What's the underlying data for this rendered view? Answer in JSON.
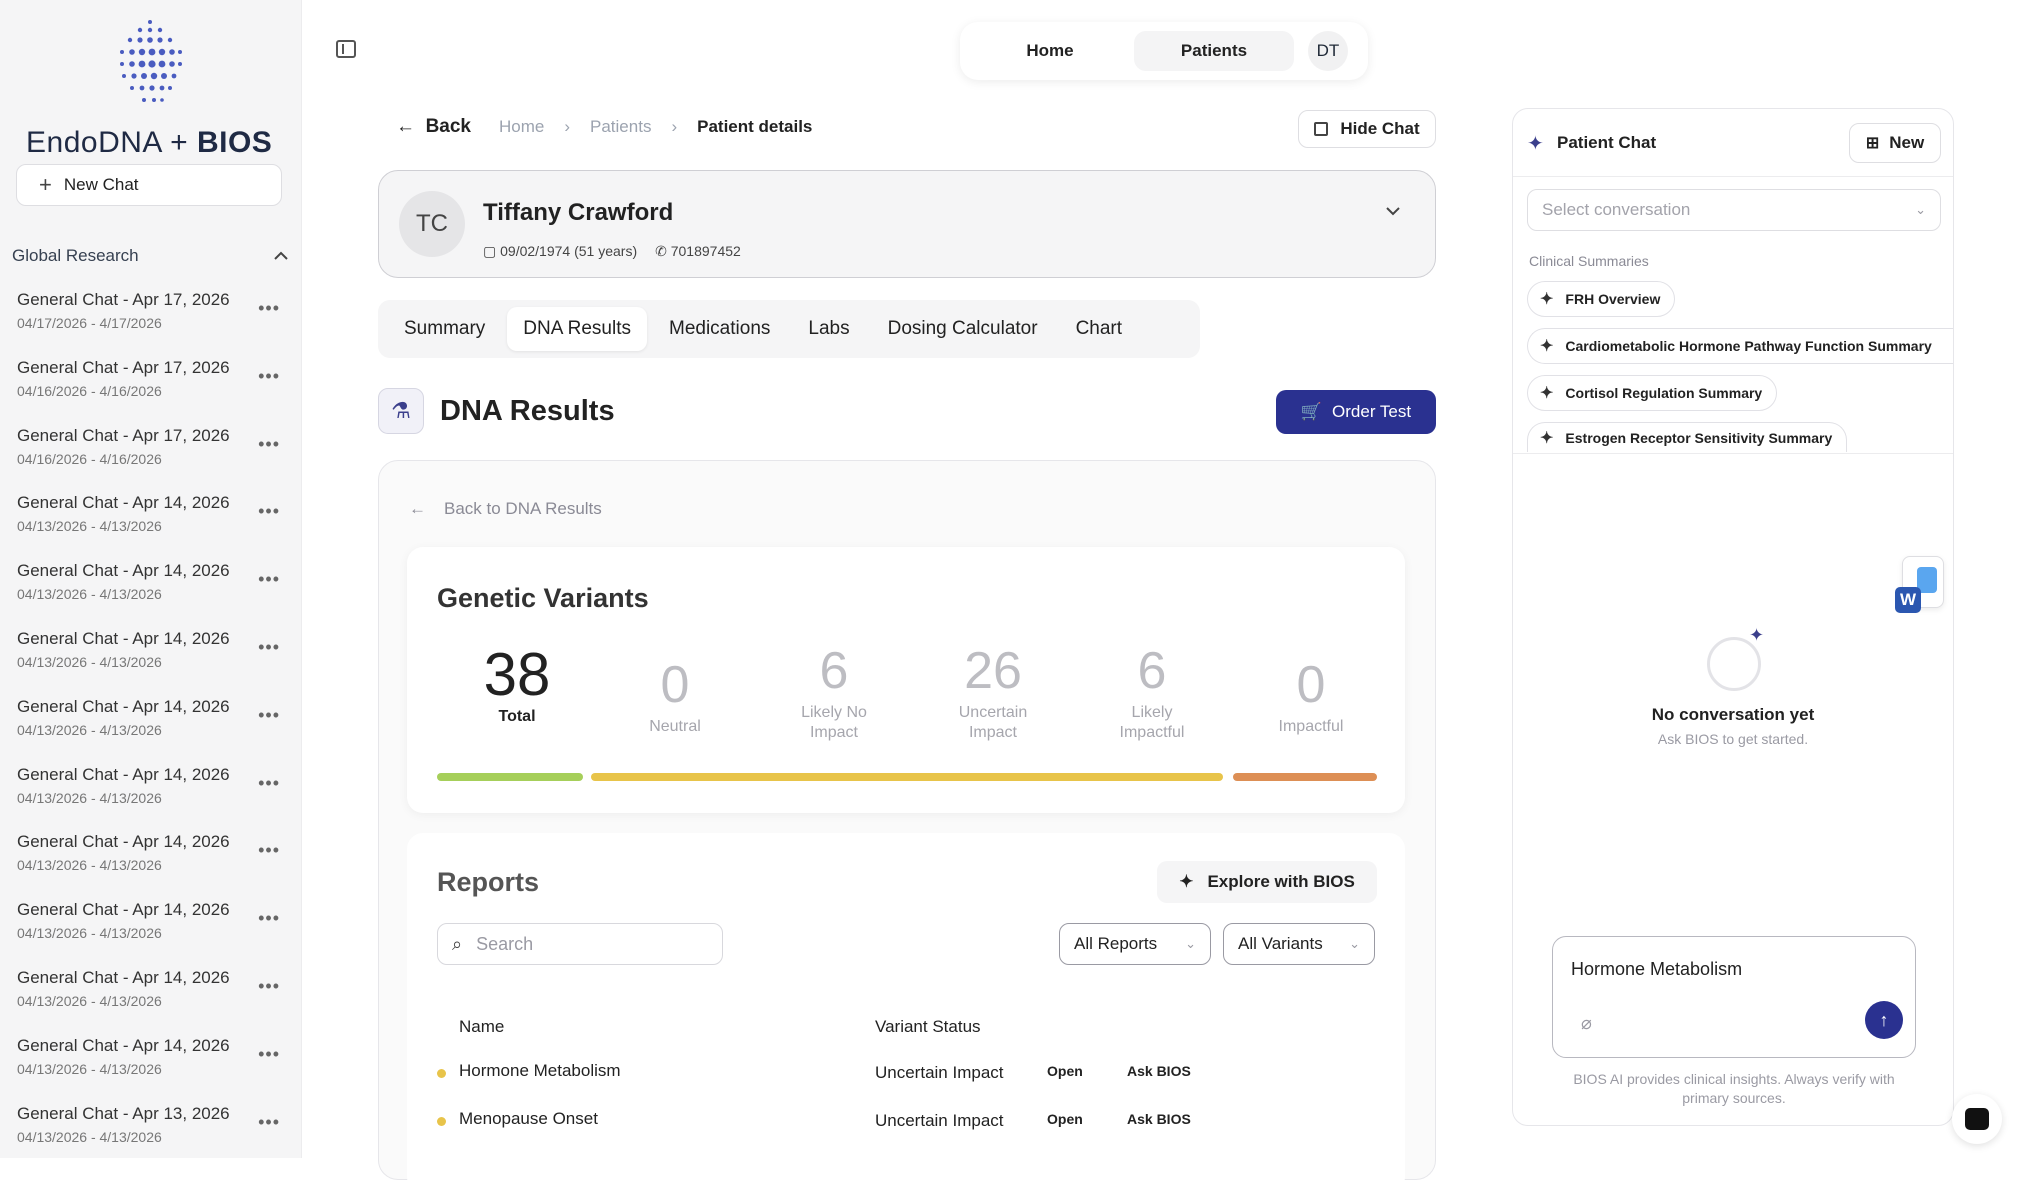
{
  "brand": {
    "name_left": "EndoDNA",
    "name_plus": "+",
    "name_right": "BIOS"
  },
  "sidebar": {
    "new_chat_label": "New Chat",
    "section_title": "Global Research",
    "chats": [
      {
        "title": "General Chat - Apr 17, 2026",
        "range": "04/17/2026 - 4/17/2026"
      },
      {
        "title": "General Chat - Apr 17, 2026",
        "range": "04/16/2026 - 4/16/2026"
      },
      {
        "title": "General Chat - Apr 17, 2026",
        "range": "04/16/2026 - 4/16/2026"
      },
      {
        "title": "General Chat - Apr 14, 2026",
        "range": "04/13/2026 - 4/13/2026"
      },
      {
        "title": "General Chat - Apr 14, 2026",
        "range": "04/13/2026 - 4/13/2026"
      },
      {
        "title": "General Chat - Apr 14, 2026",
        "range": "04/13/2026 - 4/13/2026"
      },
      {
        "title": "General Chat - Apr 14, 2026",
        "range": "04/13/2026 - 4/13/2026"
      },
      {
        "title": "General Chat - Apr 14, 2026",
        "range": "04/13/2026 - 4/13/2026"
      },
      {
        "title": "General Chat - Apr 14, 2026",
        "range": "04/13/2026 - 4/13/2026"
      },
      {
        "title": "General Chat - Apr 14, 2026",
        "range": "04/13/2026 - 4/13/2026"
      },
      {
        "title": "General Chat - Apr 14, 2026",
        "range": "04/13/2026 - 4/13/2026"
      },
      {
        "title": "General Chat - Apr 14, 2026",
        "range": "04/13/2026 - 4/13/2026"
      },
      {
        "title": "General Chat - Apr 13, 2026",
        "range": "04/13/2026 - 4/13/2026"
      }
    ]
  },
  "topnav": {
    "home": "Home",
    "patients": "Patients",
    "user_initials": "DT"
  },
  "breadcrumb": {
    "back": "Back",
    "home": "Home",
    "patients": "Patients",
    "current": "Patient details"
  },
  "hide_chat_label": "Hide Chat",
  "patient": {
    "initials": "TC",
    "name": "Tiffany Crawford",
    "dob": "09/02/1974 (51 years)",
    "phone": "701897452"
  },
  "tabs": [
    "Summary",
    "DNA Results",
    "Medications",
    "Labs",
    "Dosing Calculator",
    "Chart"
  ],
  "active_tab": "DNA Results",
  "dna": {
    "title": "DNA Results",
    "order_label": "Order Test",
    "back_label": "Back to DNA Results"
  },
  "variants": {
    "title": "Genetic Variants",
    "total": {
      "value": "38",
      "label": "Total"
    },
    "stats": [
      {
        "value": "0",
        "label": "Neutral"
      },
      {
        "value": "6",
        "label": "Likely No Impact"
      },
      {
        "value": "26",
        "label": "Uncertain Impact"
      },
      {
        "value": "6",
        "label": "Likely Impactful"
      },
      {
        "value": "0",
        "label": "Impactful"
      }
    ],
    "bar_colors": {
      "green": "#a6cf5a",
      "yellow": "#e8c44a",
      "orange": "#dd8f55"
    }
  },
  "reports": {
    "title": "Reports",
    "explore_label": "Explore with BIOS",
    "search_placeholder": "Search",
    "filter_reports": "All Reports",
    "filter_variants": "All Variants",
    "col_name": "Name",
    "col_status": "Variant Status",
    "rows": [
      {
        "name": "Hormone Metabolism",
        "status": "Uncertain Impact",
        "open": "Open",
        "ask": "Ask BIOS"
      },
      {
        "name": "Menopause Onset",
        "status": "Uncertain Impact",
        "open": "Open",
        "ask": "Ask BIOS"
      }
    ]
  },
  "chat": {
    "title": "Patient Chat",
    "new_label": "New",
    "select_placeholder": "Select conversation",
    "summaries_label": "Clinical Summaries",
    "summaries": [
      "FRH Overview",
      "Cardiometabolic Hormone Pathway Function Summary",
      "Cortisol Regulation Summary",
      "Estrogen Receptor Sensitivity Summary"
    ],
    "empty_title": "No conversation yet",
    "empty_sub": "Ask BIOS to get started.",
    "input_value": "Hormone Metabolism",
    "disclaimer": "BIOS AI provides clinical insights. Always verify with primary sources."
  },
  "colors": {
    "accent": "#2a3190",
    "status_dot": "#e8c44a"
  }
}
